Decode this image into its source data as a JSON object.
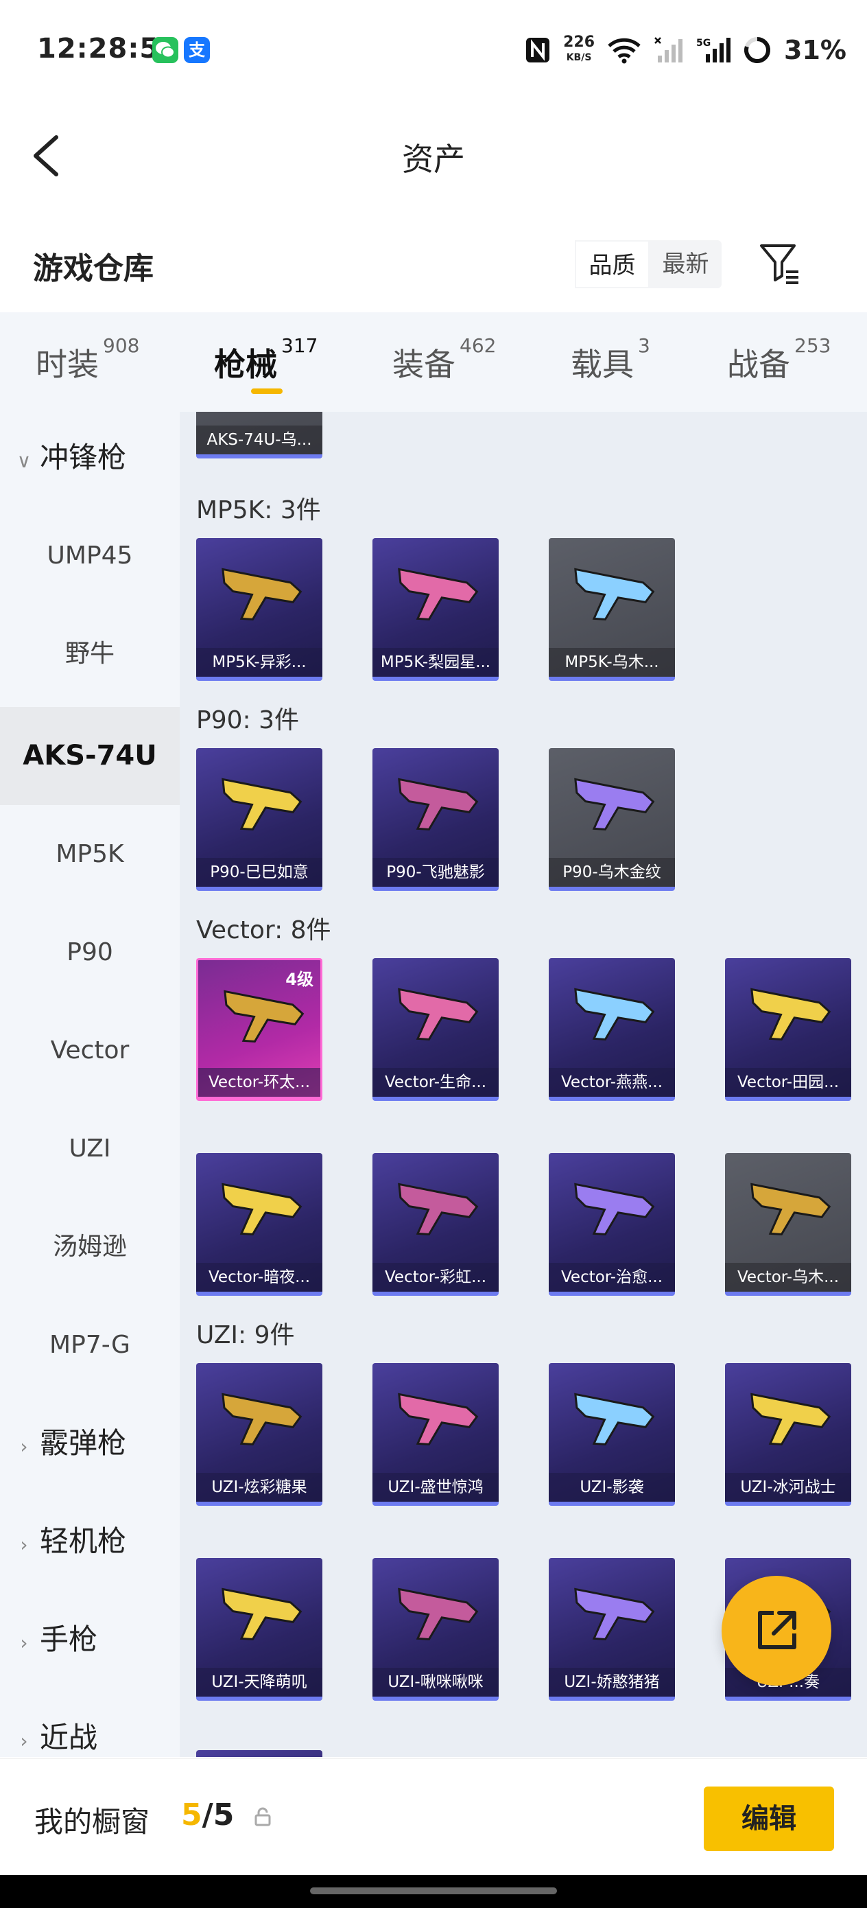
{
  "status_bar": {
    "time": "12:28:58",
    "apps": [
      {
        "name": "wechat-icon",
        "color": "#27c15c"
      },
      {
        "name": "alipay-icon",
        "label": "支",
        "color": "#1677ff"
      }
    ],
    "net_speed_value": "226",
    "net_speed_unit": "KB/S",
    "battery_percent": "31%"
  },
  "header": {
    "title": "资产"
  },
  "section": {
    "title": "游戏仓库",
    "sort_options": [
      "品质",
      "最新"
    ],
    "active_sort": 0
  },
  "tabs": [
    {
      "label": "时装",
      "count": "908"
    },
    {
      "label": "枪械",
      "count": "317"
    },
    {
      "label": "装备",
      "count": "462"
    },
    {
      "label": "载具",
      "count": "3"
    },
    {
      "label": "战备",
      "count": "253"
    }
  ],
  "active_tab": 1,
  "sidebar": {
    "expanded_group": "冲锋枪",
    "items": [
      "UMP45",
      "野牛",
      "AKS-74U",
      "MP5K",
      "P90",
      "Vector",
      "UZI",
      "汤姆逊",
      "MP7-G"
    ],
    "active_item": "AKS-74U",
    "groups_collapsed": [
      "霰弹枪",
      "轻机枪",
      "手枪",
      "近战"
    ]
  },
  "content": {
    "partial_card": {
      "label": "AKS-74U-乌..."
    },
    "categories": [
      {
        "title": "MP5K: 3件",
        "items": [
          "MP5K-异彩...",
          "MP5K-梨园星...",
          "MP5K-乌木..."
        ]
      },
      {
        "title": "P90: 3件",
        "items": [
          "P90-巳巳如意",
          "P90-飞驰魅影",
          "P90-乌木金纹"
        ]
      },
      {
        "title": "Vector: 8件",
        "items": [
          "Vector-环太...",
          "Vector-生命...",
          "Vector-燕燕...",
          "Vector-田园...",
          "Vector-暗夜...",
          "Vector-彩虹...",
          "Vector-治愈...",
          "Vector-乌木..."
        ]
      },
      {
        "title": "UZI: 9件",
        "items": [
          "UZI-炫彩糖果",
          "UZI-盛世惊鸿",
          "UZI-影袭",
          "UZI-冰河战士",
          "UZI-天降萌叽",
          "UZI-啾咪啾咪",
          "UZI-娇憨猪猪",
          "UZI-...奏"
        ]
      }
    ],
    "level_badge": "4级"
  },
  "bottom_bar": {
    "label": "我的橱窗",
    "current": "5",
    "total": "/5",
    "edit_label": "编辑"
  },
  "colors": {
    "accent": "#f5b700",
    "card_purple": "#2b2464",
    "card_grey": "#4e5058",
    "card_pink": "#b22aa6"
  }
}
